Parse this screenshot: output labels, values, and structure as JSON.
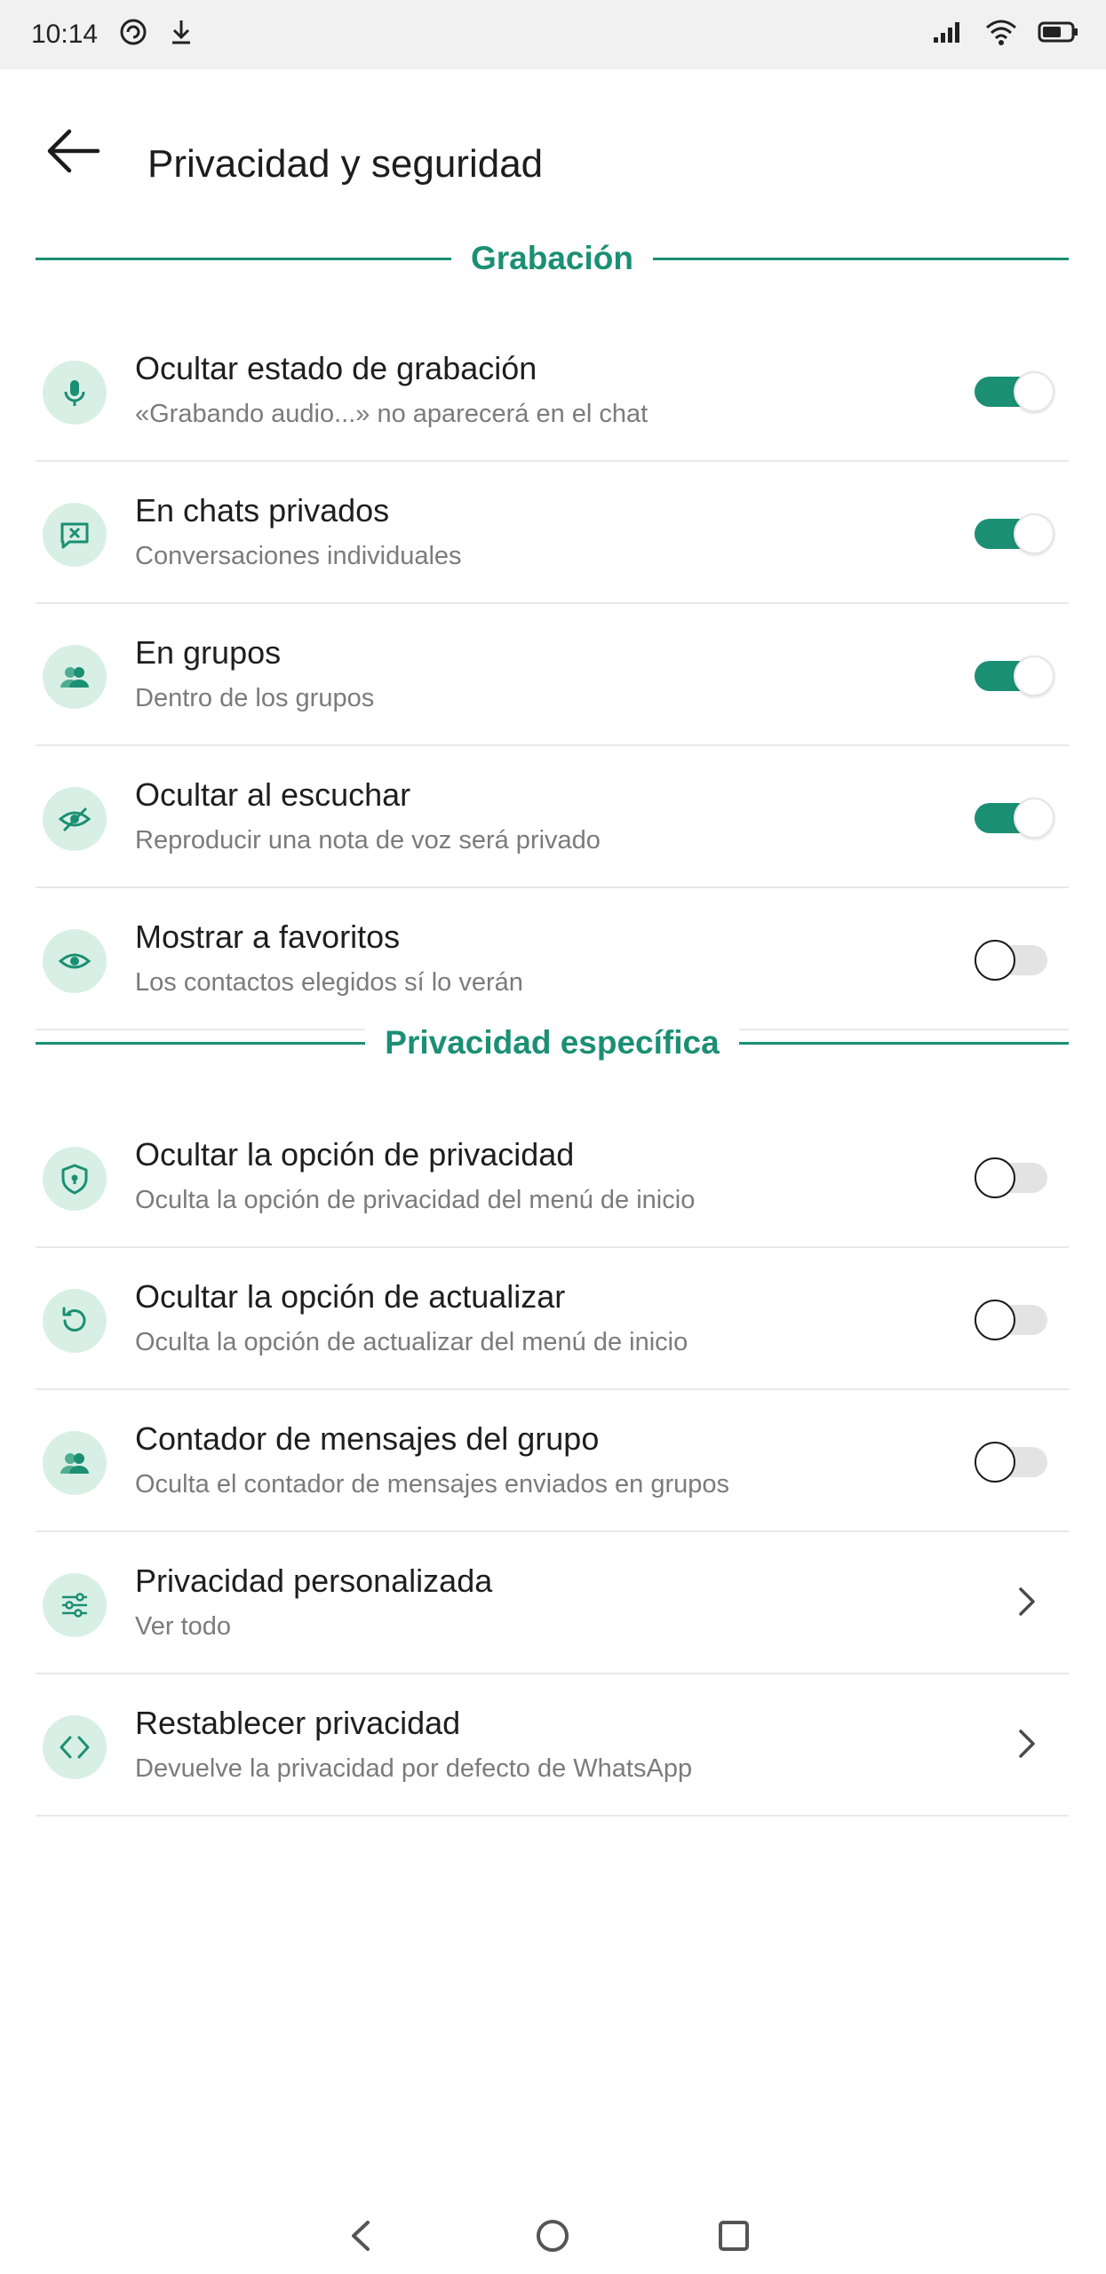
{
  "status_bar": {
    "time": "10:14",
    "left_icons": [
      "data-saver-icon",
      "download-icon"
    ],
    "right_icons": [
      "signal-icon",
      "wifi-icon",
      "battery-icon"
    ]
  },
  "header": {
    "title": "Privacidad y seguridad",
    "back_icon": "back-arrow-icon"
  },
  "theme": {
    "accent": "#1b8f73",
    "icon_bg": "#d8efe6"
  },
  "sections": [
    {
      "title": "Grabación",
      "items": [
        {
          "label": "Ocultar estado de grabación",
          "sub": "«Grabando audio...» no aparecerá en el chat",
          "icon": "microphone-icon",
          "toggle": true
        },
        {
          "label": "En chats privados",
          "sub": "Conversaciones individuales",
          "icon": "chat-blocked-icon",
          "toggle": true
        },
        {
          "label": "En grupos",
          "sub": "Dentro de los grupos",
          "icon": "group-icon",
          "toggle": true
        },
        {
          "label": "Ocultar al escuchar",
          "sub": "Reproducir una nota de voz será privado",
          "icon": "eye-off-icon",
          "toggle": true
        },
        {
          "label": "Mostrar a favoritos",
          "sub": "Los contactos elegidos sí lo verán",
          "icon": "eye-icon",
          "toggle": false
        }
      ]
    },
    {
      "title": "Privacidad específica",
      "items": [
        {
          "label": "Ocultar la opción de privacidad",
          "sub": "Oculta la opción de privacidad del menú de inicio",
          "icon": "shield-icon",
          "toggle": false
        },
        {
          "label": "Ocultar la opción de actualizar",
          "sub": "Oculta la opción de actualizar del menú de inicio",
          "icon": "refresh-icon",
          "toggle": false
        },
        {
          "label": "Contador de mensajes del grupo",
          "sub": "Oculta el contador de mensajes enviados en grupos",
          "icon": "group-icon",
          "toggle": false
        },
        {
          "label": "Privacidad personalizada",
          "sub": "Ver todo",
          "icon": "sliders-icon",
          "toggle": null
        },
        {
          "label": "Restablecer privacidad",
          "sub": "Devuelve la privacidad por defecto de WhatsApp",
          "icon": "code-icon",
          "toggle": null
        }
      ]
    }
  ],
  "nav_bar": {
    "buttons": [
      "nav-back-icon",
      "nav-home-icon",
      "nav-recents-icon"
    ]
  }
}
